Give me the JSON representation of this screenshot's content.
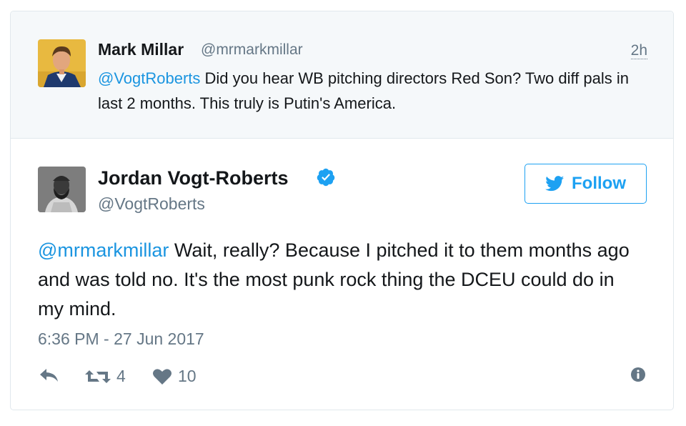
{
  "quoted_tweet": {
    "author_name": "Mark Millar",
    "author_handle": "@mrmarkmillar",
    "time": "2h",
    "mention": "@VogtRoberts",
    "text": " Did you hear WB pitching directors Red Son? Two diff pals in last 2 months. This truly is Putin's America."
  },
  "tweet": {
    "author_name": "Jordan Vogt-Roberts",
    "author_handle": "@VogtRoberts",
    "verified_icon": "verified-badge-icon",
    "follow_label": "Follow",
    "mention": "@mrmarkmillar",
    "text": " Wait, really? Because I pitched it to them months ago and was told no. It's the most punk rock thing the DCEU could do in my mind.",
    "timestamp": "6:36 PM - 27 Jun 2017",
    "retweet_count": "4",
    "like_count": "10"
  },
  "colors": {
    "accent": "#1da1f2",
    "mention": "#1b95e0",
    "muted": "#657786",
    "quoted_bg": "#f5f8fa"
  }
}
